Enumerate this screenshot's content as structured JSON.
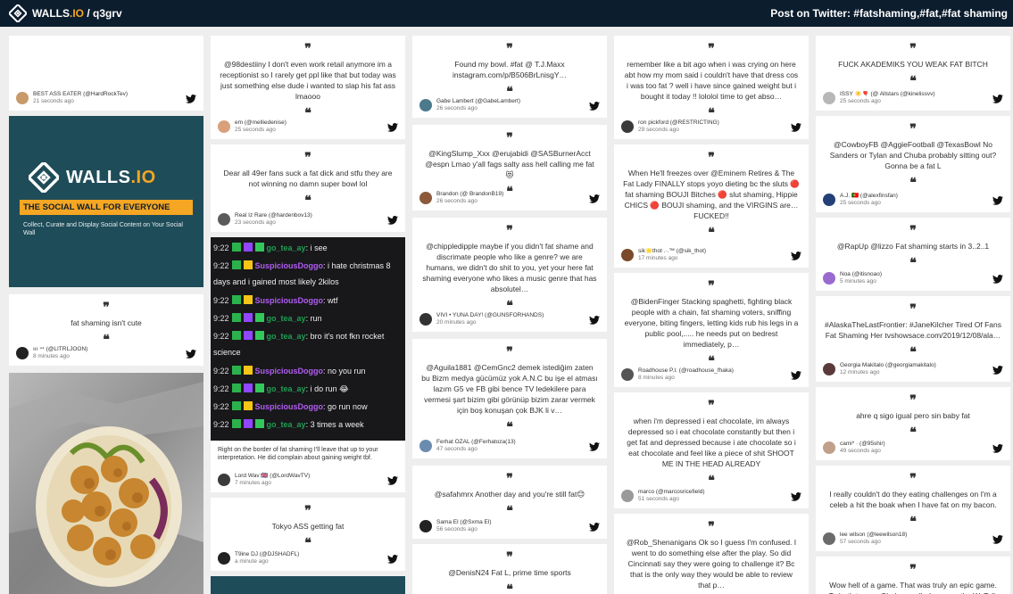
{
  "topbar": {
    "brand": "WALLS",
    "brand_accent": ".IO",
    "slug": " / q3grv",
    "post_info": "Post on Twitter: #fatshaming,#fat,#fat shaming"
  },
  "ad": {
    "logo_text": "WALLS",
    "logo_accent": ".IO",
    "tagline": "THE SOCIAL WALL FOR EVERYONE",
    "sub": "Collect, Curate and Display Social Content on Your Social Wall"
  },
  "colors": {
    "topbar": "#0c1d2e",
    "accent": "#f5a623",
    "ad_bg": "#1f4c59",
    "twitter": "#111111"
  },
  "cards": {
    "c1a": {
      "author": "BEST ASS EATER (@HardRockTev)",
      "time": "21 seconds ago"
    },
    "c1c": {
      "text": "fat shaming isn't cute",
      "author": "ııı ⁴⁴ (@LITRLJOON)",
      "time": "8 minutes ago"
    },
    "c2a": {
      "text": "@98destiiny I don't even work retail anymore im a receptionist so I rarely get ppl like that but today was just something else dude i wanted to slap his fat ass lmaooo",
      "author": "em (@melliedenise)",
      "time": "25 seconds ago"
    },
    "c2b": {
      "text": "Dear all 49er fans suck a fat dick and stfu they are not winning no damn super bowl lol",
      "author": "Real Iz Rare (@hardenbov13)",
      "time": "23 seconds ago"
    },
    "c2c": {
      "text": "Right on the border of fat shaming I'll leave that up to your interpretation. He did complain about gaining weight tbf.",
      "author": "Lord Wav 🇬🇧 (@LordWavTV)",
      "time": "7 minutes ago"
    },
    "c2d": {
      "text": "Tokyo ASS getting fat",
      "author": "T9ine DJ (@DJSHADFL)",
      "time": "a minute ago"
    },
    "c3a": {
      "text": "Found my bowl. #fat @ T.J.Maxx instagram.com/p/B506BrLnisgY…",
      "author": "Gabe Lambert (@GabeLambert)",
      "time": "26 seconds ago"
    },
    "c3b": {
      "text": "@KingSlump_Xxx @erujabidi @SASBurnerAcct @espn Lmao y'all fags salty ass hell calling me fat😻",
      "author": "Brandon (@ BrandonB19)",
      "time": "26 seconds ago"
    },
    "c3c": {
      "text": "@chippledipple maybe if you didn't fat shame and discrimate people who like a genre? we are humans, we didn't do shit to you, yet your here fat shaming everyone who likes a music genre that has absolutel…",
      "author": "VIVI • YUNA DAY! (@GUNSFORHANDS)",
      "time": "20 minutes ago"
    },
    "c3d": {
      "text": "@Aguila1881 @CemGnc2 demek istediğim zaten bu Bizm medya gücümüz yok A.N.C bu işe el atması lazım G5 ve FB gibi bence TV ledekilere para vermesi şart bizim gibi görünüp bizim zarar vermek için boş konuşan çok BJK li v…",
      "author": "Ferhat ÖZAL (@Ferhatoza(13)",
      "time": "47 seconds ago"
    },
    "c3e": {
      "text": "@safahmrx Another day and you're still fat😊",
      "author": "Sama El (@Sxma El)",
      "time": "56 seconds ago"
    },
    "c3f": {
      "text": "@DenisN24 Fat L, prime time sports"
    },
    "c4a": {
      "text": "remember like a bit ago when i was crying on here abt how my mom said i couldn't have that dress cos i was too fat ? well i have since gained weight but i bought it today !! lololol time to get abso…",
      "author": "ron pickford (@RESTRICTING)",
      "time": "29 seconds ago"
    },
    "c4b": {
      "text": "When He'll freezes over @Eminem Retires & The Fat Lady FINALLY stops yoyo dieting bc the sluts 🔴 fat shaming BOUJI Bitches 🔴 slut shaming, Hippie CHICS 🔴 BOUJI shaming, and the VIRGINS are…FUCKED!!",
      "author": "sik🌟thot .·.™ (@sik_thot)",
      "time": "17 minutes ago"
    },
    "c4c": {
      "text": "@BidenFinger Stacking spaghetti, fighting black people with a chain, fat shaming voters, sniffing everyone, biting fingers, letting kids rub his legs in a public pool,..... he needs put on bedrest immediately, p…",
      "author": "Roadhouse P.I. (@roadhouse_fhaka)",
      "time": "8 minutes ago"
    },
    "c4d": {
      "text": "when i'm depressed i eat chocolate, im always depressed so i eat chocolate constantly but then i get fat and depressed because i ate chocolate so i eat chocolate and feel like a piece of shit SHOOT ME IN THE HEAD ALREADY",
      "author": "marco (@marcosricefield)",
      "time": "51 seconds ago"
    },
    "c4e": {
      "text": "@Rob_Shenanigans Ok so I guess I'm confused. I went to do something else after the play. So did Cincinnati say they were going to challenge it? Bc that is the only way they would be able to review that p…"
    },
    "c5a": {
      "text": "FUCK AKADEMIKS YOU WEAK FAT BITCH",
      "author": "ISSY ☀️🎈 (@ Allstars (@kinelissvv)",
      "time": "25 seconds ago"
    },
    "c5b": {
      "text": "@CowboyFB @AggieFootball @TexasBowl No Sanders or Tylan and Chuba probably sitting out? Gonna be a fat L",
      "author": "A.J. 🇵🇹 (@alexfinsfan)",
      "time": "25 seconds ago"
    },
    "c5c": {
      "text": "@RapUp @lizzo Fat shaming starts in 3..2..1",
      "author": "Noa (@itisnoao)",
      "time": "5 minutes ago"
    },
    "c5d": {
      "text": "#AlaskaTheLastFrontier: #JaneKilcher Tired Of Fans Fat Shaming Her tvshowsace.com/2019/12/08/ala…",
      "author": "Georgia Makitalo (@georgiamakitalo)",
      "time": "12 minutes ago"
    },
    "c5e": {
      "text": "ahre q sigo igual pero sin baby fat",
      "author": "cami* · (@95shir)",
      "time": "49 seconds ago"
    },
    "c5f": {
      "text": "I really couldn't do they eating challenges on I'm a celeb a hit the boak when I have fat on my bacon.",
      "author": "lee wilson (@leewilson18)",
      "time": "57 seconds ago"
    },
    "c5g": {
      "text": "Wow hell of a game. That was truly an epic game. To both teams. Glad we pulled away w the W. Talk about…"
    }
  },
  "chat": {
    "lines": [
      {
        "ts": "9:22",
        "user": "go_tea_ay",
        "color": "green",
        "msg": ": i see"
      },
      {
        "ts": "9:22",
        "user": "SuspiciousDoggo",
        "color": "purple",
        "msg": ": i hate christmas 8"
      },
      {
        "ts": "",
        "user": "",
        "color": "",
        "msg": "days and i gained most likely 2kilos"
      },
      {
        "ts": "9:22",
        "user": "SuspiciousDoggo",
        "color": "purple",
        "msg": ": wtf"
      },
      {
        "ts": "9:22",
        "user": "go_tea_ay",
        "color": "green",
        "msg": ": run"
      },
      {
        "ts": "9:22",
        "user": "go_tea_ay",
        "color": "green",
        "msg": ": bro it's not fkn rocket"
      },
      {
        "ts": "",
        "user": "",
        "color": "",
        "msg": "science"
      },
      {
        "ts": "9:22",
        "user": "SuspiciousDoggo",
        "color": "purple",
        "msg": ": no you run"
      },
      {
        "ts": "9:22",
        "user": "go_tea_ay",
        "color": "green",
        "msg": ": i do run 😂"
      },
      {
        "ts": "9:22",
        "user": "SuspiciousDoggo",
        "color": "purple",
        "msg": ": go run now"
      },
      {
        "ts": "9:22",
        "user": "go_tea_ay",
        "color": "green",
        "msg": ": 3 times a week"
      }
    ]
  }
}
